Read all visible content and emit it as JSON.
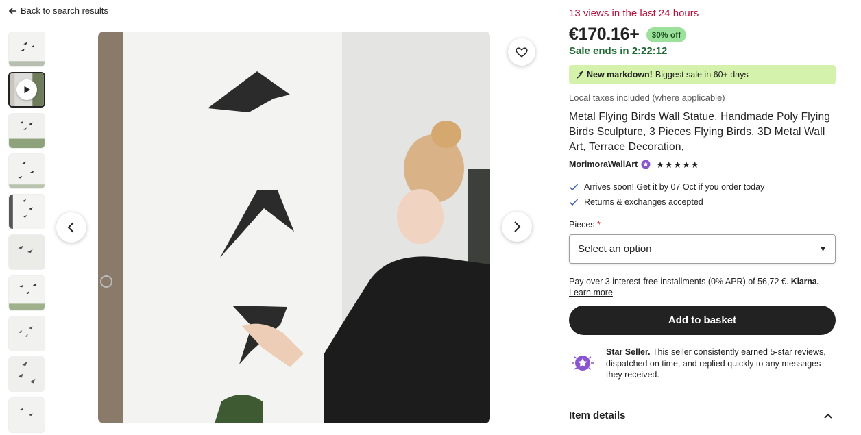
{
  "nav": {
    "back_label": "Back to search results",
    "back_icon": "arrow-left-icon"
  },
  "gallery": {
    "thumbnail_count": 10,
    "active_index": 1,
    "video_thumbnail_index": 1
  },
  "listing": {
    "views_notice": "13 views in the last 24 hours",
    "price": "€170.16+",
    "discount_badge": "30% off",
    "sale_ends": "Sale ends in 2:22:12",
    "markdown_bold": "New markdown!",
    "markdown_text": "Biggest sale in 60+ days",
    "taxes_note": "Local taxes included (where applicable)",
    "title": "Metal Flying Birds Wall Statue, Handmade Poly Flying Birds Sculpture, 3 Pieces Flying Birds, 3D Metal Wall Art, Terrace Decoration,",
    "seller_name": "MorimoraWallArt",
    "rating_stars": 5,
    "arrives_prefix": "Arrives soon! Get it by ",
    "arrives_date": "07 Oct",
    "arrives_suffix": " if you order today",
    "returns_text": "Returns & exchanges accepted",
    "pieces_label": "Pieces",
    "pieces_required_marker": "*",
    "select_placeholder": "Select an option",
    "installments_text": "Pay over 3 interest-free installments (0% APR) of 56,72 €.",
    "installments_brand": "Klarna.",
    "learn_more": "Learn more",
    "add_to_basket": "Add to basket",
    "star_seller_title": "Star Seller.",
    "star_seller_text": "This seller consistently earned 5-star reviews, dispatched on time, and replied quickly to any messages they received.",
    "item_details": "Item details"
  },
  "colors": {
    "views_red": "#b7123c",
    "sale_green": "#1d6b33",
    "discount_bg": "#9ce19b",
    "markdown_bg": "#d4f2ab",
    "button_dark": "#222222",
    "star_seller_purple": "#7f3fbf"
  }
}
